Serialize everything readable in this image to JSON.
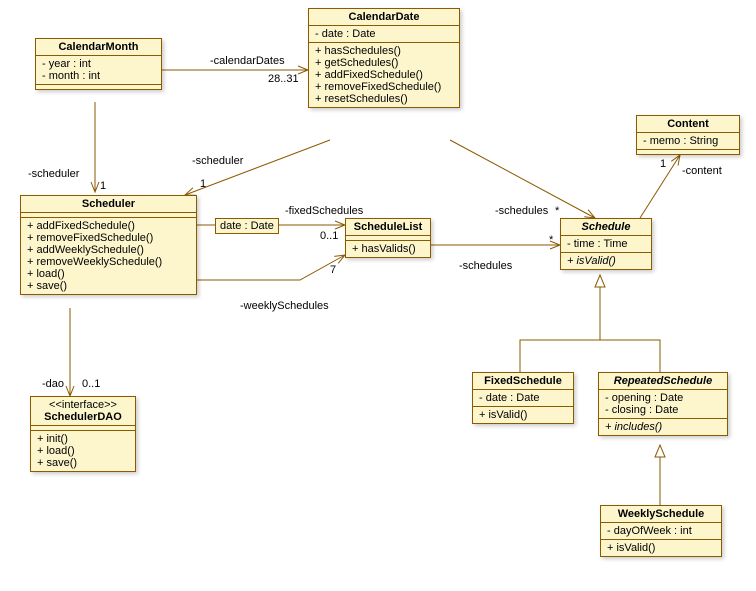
{
  "classes": {
    "CalendarMonth": {
      "name": "CalendarMonth",
      "attrs": [
        "- year : int",
        "- month : int"
      ],
      "ops": []
    },
    "CalendarDate": {
      "name": "CalendarDate",
      "attrs": [
        "- date : Date"
      ],
      "ops": [
        "+ hasSchedules()",
        "+ getSchedules()",
        "+ addFixedSchedule()",
        "+ removeFixedSchedule()",
        "+ resetSchedules()"
      ]
    },
    "Content": {
      "name": "Content",
      "attrs": [
        "- memo : String"
      ],
      "ops": []
    },
    "Scheduler": {
      "name": "Scheduler",
      "attrs": [],
      "ops": [
        "+ addFixedSchedule()",
        "+ removeFixedSchedule()",
        "+ addWeeklySchedule()",
        "+ removeWeeklySchedule()",
        "+ load()",
        "+ save()"
      ]
    },
    "SchedulerDAO": {
      "stereo": "<<interface>>",
      "name": "SchedulerDAO",
      "attrs": [],
      "ops": [
        "+ init()",
        "+ load()",
        "+ save()"
      ]
    },
    "ScheduleList": {
      "name": "ScheduleList",
      "attrs": [],
      "ops": [
        "+ hasValids()"
      ]
    },
    "Schedule": {
      "name": "Schedule",
      "italic": true,
      "attrs": [
        "- time : Time"
      ],
      "ops": [
        "+ isValid()"
      ]
    },
    "FixedSchedule": {
      "name": "FixedSchedule",
      "attrs": [
        "- date : Date"
      ],
      "ops": [
        "+ isValid()"
      ]
    },
    "RepeatedSchedule": {
      "name": "RepeatedSchedule",
      "italic": true,
      "attrs": [
        "- opening : Date",
        "- closing : Date"
      ],
      "ops": [
        "+ includes()"
      ]
    },
    "WeeklySchedule": {
      "name": "WeeklySchedule",
      "attrs": [
        "- dayOfWeek : int"
      ],
      "ops": [
        "+ isValid()"
      ]
    }
  },
  "assocClass": {
    "label": "date : Date"
  },
  "labels": {
    "calendarDates": "-calendarDates",
    "mult28_31": "28..31",
    "scheduler1": "-scheduler",
    "scheduler2": "-scheduler",
    "one_a": "1",
    "one_b": "1",
    "fixedSchedules": "-fixedSchedules",
    "mult01": "0..1",
    "weeklySchedules": "-weeklySchedules",
    "seven": "7",
    "schedules1": "-schedules",
    "schedules2": "-schedules",
    "star1": "*",
    "star2": "*",
    "content": "-content",
    "one_c": "1",
    "dao": "-dao",
    "mult01b": "0..1"
  }
}
